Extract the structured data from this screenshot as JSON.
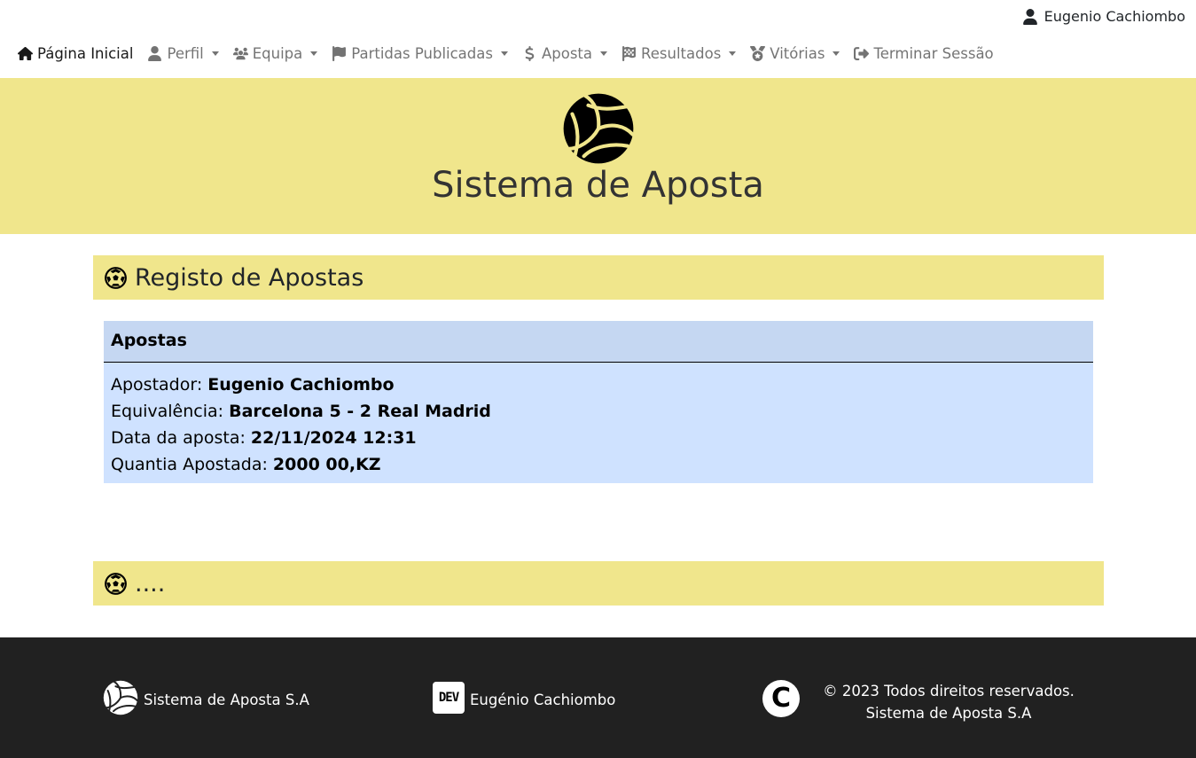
{
  "user": {
    "name": "Eugenio Cachiombo",
    "icon": "user-icon"
  },
  "nav": [
    {
      "label": "Página Inicial",
      "icon": "home-icon",
      "dropdown": false,
      "active": true
    },
    {
      "label": "Perfil",
      "icon": "user-icon",
      "dropdown": true
    },
    {
      "label": "Equipa",
      "icon": "users-icon",
      "dropdown": true
    },
    {
      "label": "Partidas Publicadas",
      "icon": "flag-icon",
      "dropdown": true
    },
    {
      "label": "Aposta",
      "icon": "dollar-icon",
      "dropdown": true
    },
    {
      "label": "Resultados",
      "icon": "checkered-flag-icon",
      "dropdown": true
    },
    {
      "label": "Vitórias",
      "icon": "medal-icon",
      "dropdown": true
    },
    {
      "label": "Terminar Sessão",
      "icon": "logout-icon",
      "dropdown": false
    }
  ],
  "hero": {
    "title": "Sistema de Aposta",
    "icon": "volleyball-icon"
  },
  "section1": {
    "title": "Registo de Apostas",
    "icon": "soccer-ball-icon"
  },
  "card": {
    "header": "Apostas",
    "rows": [
      {
        "label": "Apostador:",
        "value": "Eugenio Cachiombo"
      },
      {
        "label": "Equivalência:",
        "value": "Barcelona 5 - 2 Real Madrid"
      },
      {
        "label": "Data da aposta:",
        "value": "22/11/2024 12:31"
      },
      {
        "label": "Quantia Apostada:",
        "value": "2000 00,KZ"
      }
    ]
  },
  "section2": {
    "title": "....",
    "icon": "soccer-ball-icon"
  },
  "footer": {
    "brand": "Sistema de Aposta S.A",
    "dev_badge": "DEV",
    "dev_name": "Eugénio Cachiombo",
    "copyright_symbol": "C",
    "copyright_line1": "© 2023 Todos direitos reservados.",
    "copyright_line2": "Sistema de Aposta S.A"
  },
  "colors": {
    "accent": "#f0e68c",
    "card": "#cfe2ff",
    "footer": "#212121"
  }
}
